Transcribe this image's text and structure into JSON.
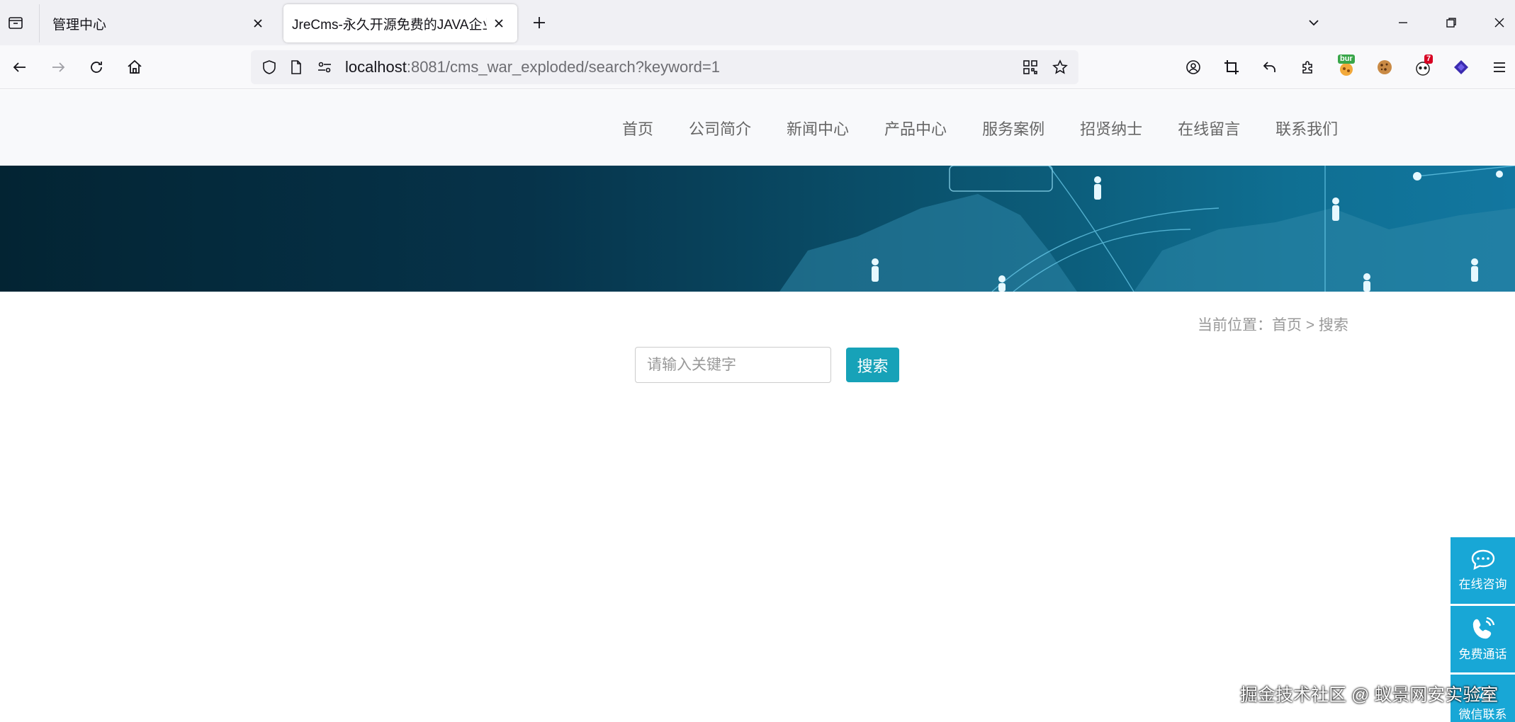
{
  "browser": {
    "tabs": [
      {
        "title": "管理中心",
        "active": false
      },
      {
        "title": "JreCms-永久开源免费的JAVA企业网",
        "active": true
      }
    ],
    "url": {
      "host": "localhost",
      "rest": ":8081/cms_war_exploded/search?keyword=1"
    },
    "extensions": {
      "burp_badge": "bur",
      "notification_count": "7"
    }
  },
  "site": {
    "nav": [
      "首页",
      "公司简介",
      "新闻中心",
      "产品中心",
      "服务案例",
      "招贤纳士",
      "在线留言",
      "联系我们"
    ],
    "breadcrumb": "当前位置：首页 > 搜索",
    "search": {
      "placeholder": "请输入关键字",
      "button_label": "搜索"
    },
    "side_contact": [
      {
        "label": "在线咨询",
        "icon": "chat-bubble-icon"
      },
      {
        "label": "免费通话",
        "icon": "phone-icon"
      },
      {
        "label": "微信联系",
        "icon": "wechat-icon"
      }
    ],
    "accent_color": "#17a2b8",
    "side_color": "#18a7d6"
  },
  "watermark": "掘金技术社区 @ 蚁景网安实验室"
}
